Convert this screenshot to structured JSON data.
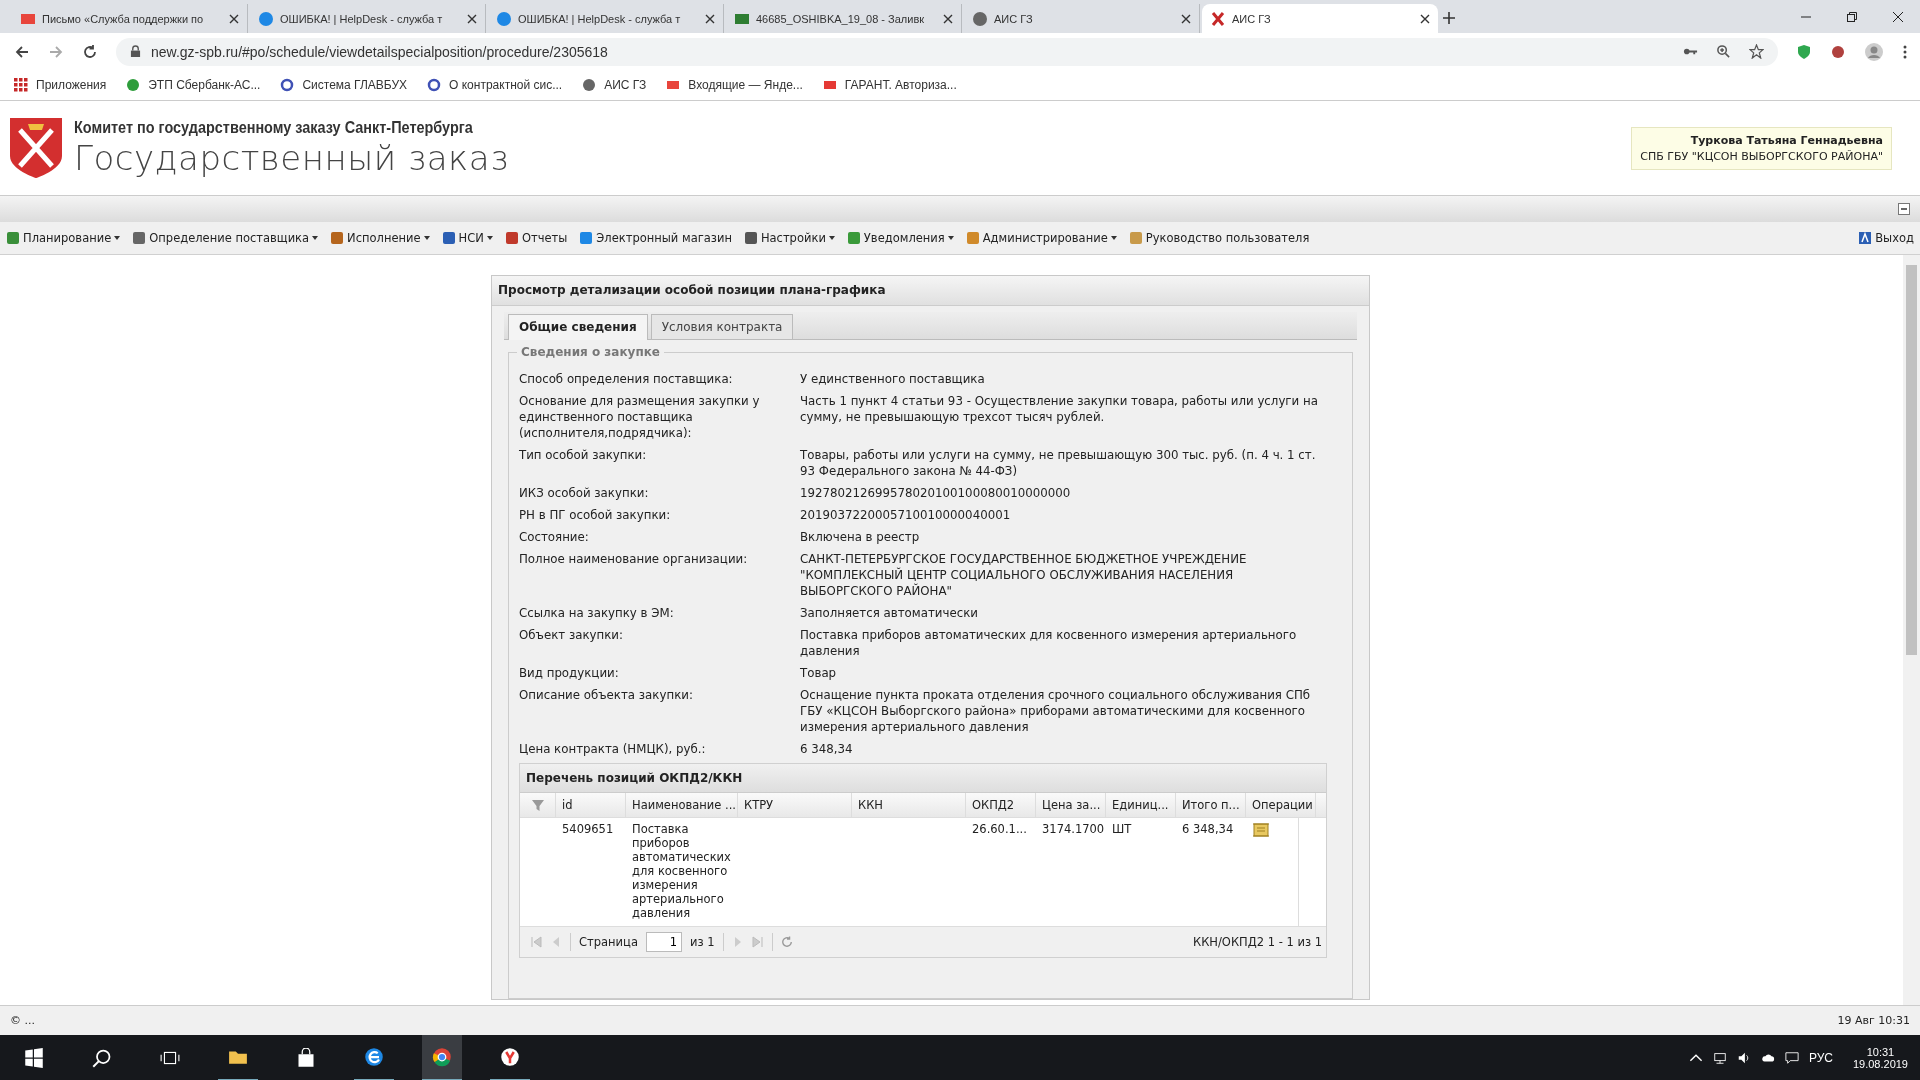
{
  "browser": {
    "tabs": [
      {
        "title": "Письмо «Служба поддержки по",
        "kind": "mail",
        "selected": false
      },
      {
        "title": "ОШИБКА! | HelpDesk - служба т",
        "kind": "globe",
        "selected": false
      },
      {
        "title": "ОШИБКА! | HelpDesk - служба т",
        "kind": "globe",
        "selected": false
      },
      {
        "title": "46685_OSHIBKA_19_08 - Заливк",
        "kind": "sheet",
        "selected": false
      },
      {
        "title": "АИС ГЗ",
        "kind": "web",
        "selected": false
      },
      {
        "title": "АИС ГЗ",
        "kind": "emblem",
        "selected": true
      }
    ],
    "address": "new.gz-spb.ru/#po/schedule/viewdetailspecialposition/procedure/2305618",
    "bookmarks": [
      {
        "label": "Приложения",
        "kind": "apps"
      },
      {
        "label": "ЭТП Сбербанк-АС...",
        "kind": "leaf"
      },
      {
        "label": "Система ГЛАВБУХ",
        "kind": "ring"
      },
      {
        "label": "О контрактной сис...",
        "kind": "ring"
      },
      {
        "label": "АИС ГЗ",
        "kind": "web"
      },
      {
        "label": "Входящие — Янде...",
        "kind": "mail"
      },
      {
        "label": "ГАРАНТ. Авториза...",
        "kind": "flag"
      }
    ]
  },
  "header": {
    "org": "Комитет по государственному заказу Санкт-Петербурга",
    "title": "Государственный заказ",
    "user_name": "Туркова Татьяна Геннадьевна",
    "user_org": "СПБ ГБУ \"КЦСОН ВЫБОРГСКОГО РАЙОНА\""
  },
  "menu": {
    "items": [
      {
        "label": "Планирование",
        "dropdown": true
      },
      {
        "label": "Определение поставщика",
        "dropdown": true
      },
      {
        "label": "Исполнение",
        "dropdown": true
      },
      {
        "label": "НСИ",
        "dropdown": true
      },
      {
        "label": "Отчеты",
        "dropdown": false
      },
      {
        "label": "Электронный магазин",
        "dropdown": false
      },
      {
        "label": "Настройки",
        "dropdown": true
      },
      {
        "label": "Уведомления",
        "dropdown": true
      },
      {
        "label": "Администрирование",
        "dropdown": true
      },
      {
        "label": "Руководство пользователя",
        "dropdown": false
      }
    ],
    "logout": "Выход"
  },
  "panel": {
    "title": "Просмотр детализации особой позиции плана-графика",
    "tabs": [
      {
        "label": "Общие сведения",
        "selected": true
      },
      {
        "label": "Условия контракта",
        "selected": false
      }
    ],
    "legend": "Сведения о закупке",
    "fields": [
      {
        "label": "Способ определения поставщика:",
        "value": "У единственного поставщика"
      },
      {
        "label": "Основание для размещения закупки у единственного поставщика (исполнителя,подрядчика):",
        "value": "Часть 1 пункт 4 статьи 93 - Осуществление закупки товара, работы или услуги на сумму, не превышающую трехсот тысяч рублей."
      },
      {
        "label": "Тип особой закупки:",
        "value": "Товары, работы или услуги на сумму, не превышающую 300 тыс. руб. (п. 4 ч. 1 ст. 93 Федерального закона № 44-ФЗ)"
      },
      {
        "label": "ИКЗ особой закупки:",
        "value": "192780212699578020100100080010000000"
      },
      {
        "label": "РН в ПГ особой закупки:",
        "value": "2019037220005710010000040001"
      },
      {
        "label": "Состояние:",
        "value": "Включена в реестр"
      },
      {
        "label": "Полное наименование организации:",
        "value": "САНКТ-ПЕТЕРБУРГСКОЕ ГОСУДАРСТВЕННОЕ БЮДЖЕТНОЕ УЧРЕЖДЕНИЕ \"КОМПЛЕКСНЫЙ ЦЕНТР СОЦИАЛЬНОГО ОБСЛУЖИВАНИЯ НАСЕЛЕНИЯ ВЫБОРГСКОГО РАЙОНА\""
      },
      {
        "label": "Ссылка на закупку в ЭМ:",
        "value": "Заполняется автоматически"
      },
      {
        "label": "Объект закупки:",
        "value": "Поставка приборов автоматических для косвенного измерения артериального давления"
      },
      {
        "label": "Вид продукции:",
        "value": "Товар"
      },
      {
        "label": "Описание объекта закупки:",
        "value": "Оснащение пункта проката отделения срочного социального обслуживания СПб ГБУ «КЦСОН Выборгского района» приборами автоматическими для косвенного измерения артериального давления"
      },
      {
        "label": "Цена контракта (НМЦК), руб.:",
        "value": "6 348,34"
      }
    ],
    "grid": {
      "title": "Перечень позиций ОКПД2/ККН",
      "columns": [
        "id",
        "Наименование ...",
        "КТРУ",
        "ККН",
        "ОКПД2",
        "Цена за...",
        "Единиц...",
        "Итого п...",
        "Операции"
      ],
      "rows": [
        [
          "5409651",
          "Поставка приборов автоматических для косвенного измерения артериального давления",
          "",
          "",
          "26.60.1...",
          "3174.1700",
          "ШТ",
          "6 348,34"
        ]
      ],
      "pager": {
        "page_label": "Страница",
        "page": "1",
        "of": "из 1",
        "summary": "ККН/ОКПД2 1 - 1 из 1"
      }
    }
  },
  "status": {
    "left": "© ...",
    "right": "19 Авг 10:31"
  },
  "taskbar": {
    "lang": "РУС",
    "time": "10:31",
    "date": "19.08.2019"
  }
}
